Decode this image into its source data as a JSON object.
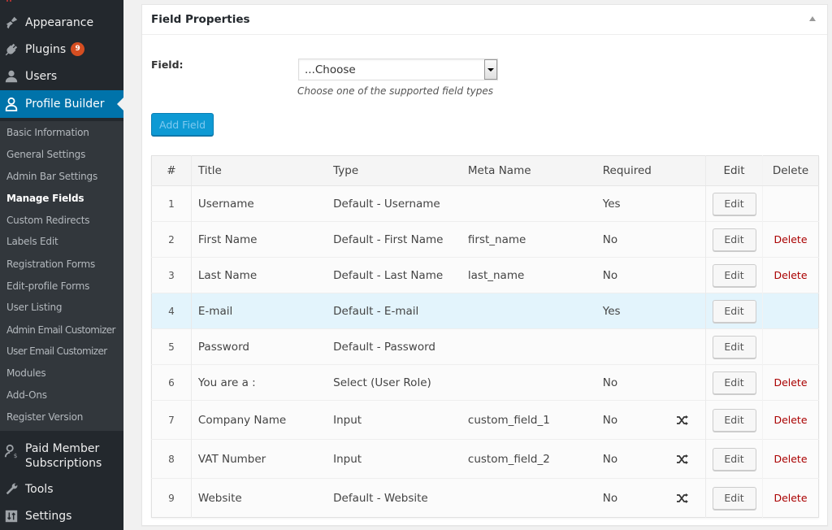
{
  "sidebar": {
    "top_items": [
      {
        "label": "Appearance",
        "icon": "paintbrush-icon"
      },
      {
        "label": "Plugins",
        "icon": "plugin-icon",
        "badge": "9"
      },
      {
        "label": "Users",
        "icon": "users-icon"
      },
      {
        "label": "Profile Builder",
        "icon": "profile-icon",
        "active": true
      }
    ],
    "submenu": [
      {
        "label": "Basic Information"
      },
      {
        "label": "General Settings"
      },
      {
        "label": "Admin Bar Settings"
      },
      {
        "label": "Manage Fields",
        "current": true
      },
      {
        "label": "Custom Redirects"
      },
      {
        "label": "Labels Edit"
      },
      {
        "label": "Registration Forms"
      },
      {
        "label": "Edit-profile Forms"
      },
      {
        "label": "User Listing"
      },
      {
        "label": "Admin Email Customizer"
      },
      {
        "label": "User Email Customizer"
      },
      {
        "label": "Modules"
      },
      {
        "label": "Add-Ons"
      },
      {
        "label": "Register Version"
      }
    ],
    "bottom_items": [
      {
        "label_line1": "Paid Member",
        "label_line2": "Subscriptions",
        "icon": "member-subscriptions-icon"
      },
      {
        "label": "Tools",
        "icon": "wrench-icon"
      },
      {
        "label": "Settings",
        "icon": "settings-icon"
      }
    ]
  },
  "panel": {
    "title": "Field Properties",
    "field_label": "Field:",
    "select_value": "...Choose",
    "select_description": "Choose one of the supported field types",
    "add_button": "Add Field"
  },
  "table": {
    "headers": {
      "num": "#",
      "title": "Title",
      "type": "Type",
      "meta": "Meta Name",
      "required": "Required",
      "edit": "Edit",
      "delete": "Delete"
    },
    "edit_label": "Edit",
    "delete_label": "Delete",
    "rows": [
      {
        "num": "1",
        "title": "Username",
        "type": "Default - Username",
        "meta": "",
        "required": "Yes",
        "deletable": false,
        "shuffle": false
      },
      {
        "num": "2",
        "title": "First Name",
        "type": "Default - First Name",
        "meta": "first_name",
        "required": "No",
        "deletable": true,
        "shuffle": false
      },
      {
        "num": "3",
        "title": "Last Name",
        "type": "Default - Last Name",
        "meta": "last_name",
        "required": "No",
        "deletable": true,
        "shuffle": false
      },
      {
        "num": "4",
        "title": "E-mail",
        "type": "Default - E-mail",
        "meta": "",
        "required": "Yes",
        "deletable": false,
        "shuffle": false,
        "highlighted": true
      },
      {
        "num": "5",
        "title": "Password",
        "type": "Default - Password",
        "meta": "",
        "required": "",
        "deletable": false,
        "shuffle": false
      },
      {
        "num": "6",
        "title": "You are a :",
        "type": "Select (User Role)",
        "meta": "",
        "required": "No",
        "deletable": true,
        "shuffle": false
      },
      {
        "num": "7",
        "title": "Company Name",
        "type": "Input",
        "meta": "custom_field_1",
        "required": "No",
        "deletable": true,
        "shuffle": true
      },
      {
        "num": "8",
        "title": "VAT Number",
        "type": "Input",
        "meta": "custom_field_2",
        "required": "No",
        "deletable": true,
        "shuffle": true
      },
      {
        "num": "9",
        "title": "Website",
        "type": "Default - Website",
        "meta": "",
        "required": "No",
        "deletable": true,
        "shuffle": true
      }
    ]
  },
  "colors": {
    "accent": "#0073aa",
    "sidebar_bg": "#23282d",
    "submenu_bg": "#32373c",
    "delete": "#a00000",
    "highlight_row": "#e3f4fc",
    "badge": "#d54e21"
  }
}
